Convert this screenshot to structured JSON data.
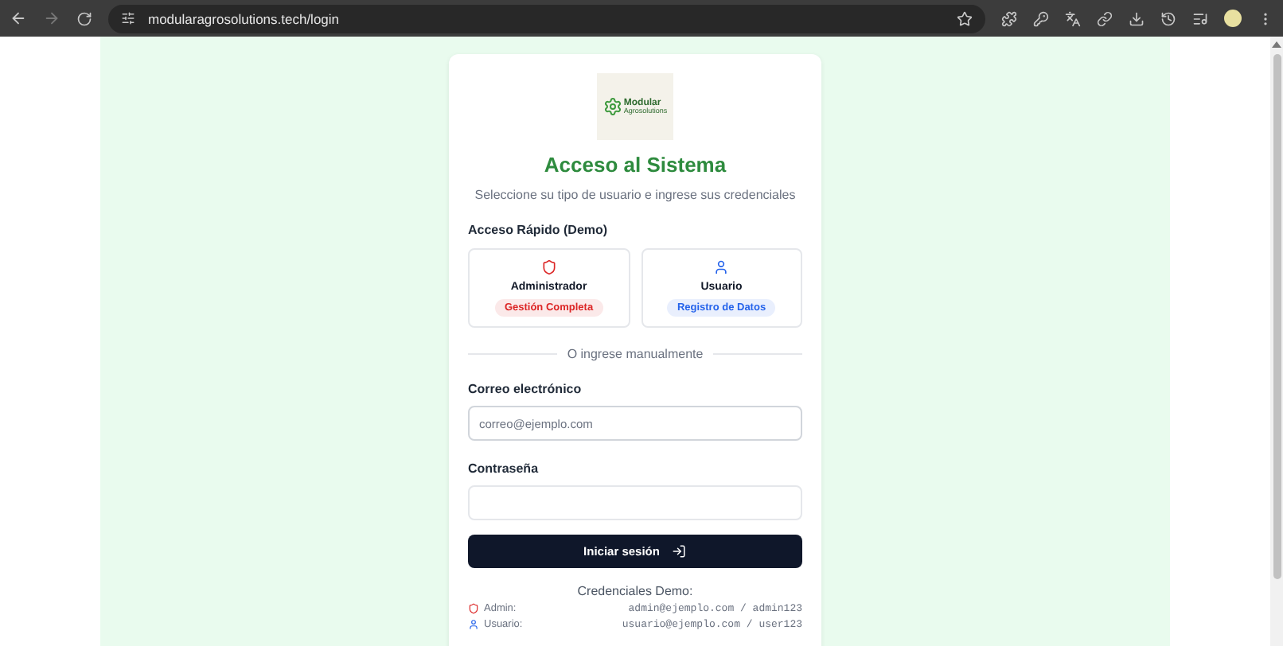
{
  "browser": {
    "url": "modularagrosolutions.tech/login"
  },
  "logo": {
    "name": "Modular",
    "tagline": "Agrosolutions"
  },
  "title": "Acceso al Sistema",
  "subtitle": "Seleccione su tipo de usuario e ingrese sus credenciales",
  "quick_access": {
    "heading": "Acceso Rápido (Demo)",
    "options": [
      {
        "kind": "admin",
        "label": "Administrador",
        "badge": "Gestión Completa",
        "color": "#dc2626"
      },
      {
        "kind": "user",
        "label": "Usuario",
        "badge": "Registro de Datos",
        "color": "#2563eb"
      }
    ]
  },
  "divider": "O ingrese manualmente",
  "fields": [
    {
      "label": "Correo electrónico",
      "placeholder": "correo@ejemplo.com",
      "focused": true
    },
    {
      "label": "Contraseña",
      "focused": false
    }
  ],
  "submit": "Iniciar sesión",
  "credentials": {
    "heading": "Credenciales Demo:",
    "rows": [
      {
        "kind": "admin",
        "role": "Admin:",
        "value": "admin@ejemplo.com / admin123"
      },
      {
        "kind": "user",
        "role": "Usuario:",
        "value": "usuario@ejemplo.com / user123"
      }
    ]
  }
}
